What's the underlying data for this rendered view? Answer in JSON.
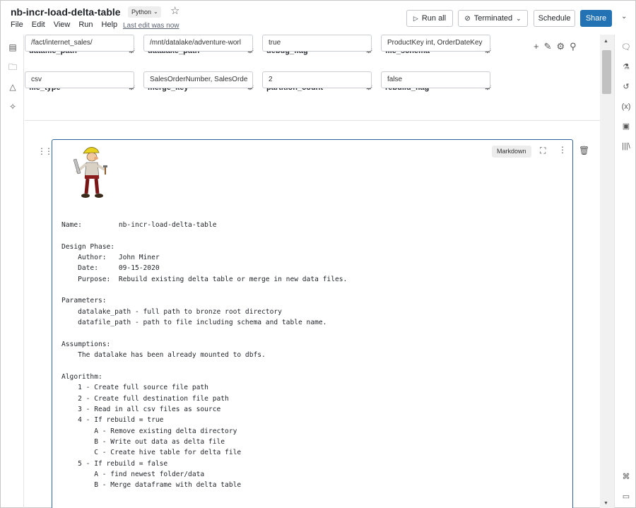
{
  "header": {
    "title": "nb-incr-load-delta-table",
    "language": "Python",
    "menu": [
      "File",
      "Edit",
      "View",
      "Run",
      "Help"
    ],
    "last_edit": "Last edit was now",
    "run_all": "Run all",
    "cluster_status": "Terminated",
    "schedule": "Schedule",
    "share": "Share"
  },
  "widgets": [
    {
      "label": "datafile_path",
      "value": "/fact/internet_sales/"
    },
    {
      "label": "datalake_path",
      "value": "/mnt/datalake/adventure-worl"
    },
    {
      "label": "debug_flag",
      "value": "true"
    },
    {
      "label": "file_schema",
      "value": "ProductKey int, OrderDateKey"
    },
    {
      "label": "file_type",
      "value": "csv"
    },
    {
      "label": "merge_key",
      "value": "SalesOrderNumber, SalesOrde"
    },
    {
      "label": "partition_count",
      "value": "2"
    },
    {
      "label": "rebuild_flag",
      "value": "false"
    }
  ],
  "cell": {
    "type_badge": "Markdown",
    "lines": [
      "Name:         nb-incr-load-delta-table",
      "",
      "Design Phase:",
      "    Author:   John Miner",
      "    Date:     09-15-2020",
      "    Purpose:  Rebuild existing delta table or merge in new data files.",
      "",
      "Parameters:",
      "    datalake_path - full path to bronze root directory",
      "    datafile_path - path to file including schema and table name.",
      "",
      "Assumptions:",
      "    The datalake has been already mounted to dbfs.",
      "",
      "Algorithm:",
      "    1 - Create full source file path",
      "    2 - Create full destination file path",
      "    3 - Read in all csv files as source",
      "    4 - If rebuild = true",
      "        A - Remove existing delta directory",
      "        B - Write out data as delta file",
      "        C - Create hive table for delta file",
      "    5 - If rebuild = false",
      "        A - find newest folder/data",
      "        B - Merge dataframe with delta table"
    ]
  },
  "icons": {
    "left_rail": [
      "table-of-contents-icon",
      "folder-icon",
      "shapes-icon",
      "sparkle-icon"
    ],
    "right_rail": [
      "comment-icon",
      "experiment-icon",
      "history-icon",
      "variables-icon",
      "chart-icon",
      "library-icon",
      "keyboard-shortcut-icon",
      "terminal-icon"
    ]
  },
  "colors": {
    "accent": "#2272b4",
    "cell_border": "#2a64a0"
  }
}
